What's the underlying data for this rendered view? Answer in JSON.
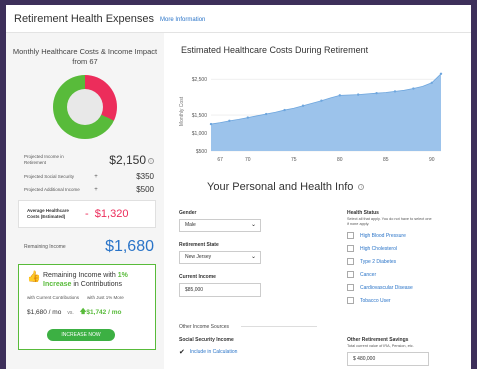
{
  "header": {
    "title": "Retirement Health Expenses",
    "more_link": "More Information"
  },
  "left": {
    "donut_title": "Monthly Healthcare Costs & Income Impact from 67",
    "donut_colors": {
      "costs": "#ec2d5b",
      "income": "#58bb3a"
    },
    "donut_cost_fraction": 0.32,
    "projected_income": {
      "label": "Projected Income in Retirement",
      "value": "$2,150"
    },
    "social_security": {
      "label": "Projected Social Security",
      "sym": "+",
      "value": "$350"
    },
    "additional_income": {
      "label": "Projected Additional Income",
      "sym": "+",
      "value": "$500"
    },
    "avg_healthcare": {
      "label": "Average Healthcare Costs (Estimated)",
      "sym": "-",
      "value": "$1,320"
    },
    "remaining": {
      "label": "Remaining Income",
      "value": "$1,680"
    },
    "promo": {
      "title_a": "Remaining Income with",
      "pct": "1%",
      "title_b": "Increase",
      "title_c": "in Contributions",
      "col_current": "with Current Contributions",
      "col_more": "with Just 1% More",
      "current_value": "$1,680 / mo",
      "vs": "vs.",
      "more_value": "$1,742 / mo",
      "button": "INCREASE NOW"
    }
  },
  "chart": {
    "title": "Estimated Healthcare Costs During Retirement",
    "ylabel": "Monthly Cost",
    "ytick_labels": [
      "$2,500",
      "$1,500",
      "$1,000",
      "$500"
    ],
    "xtick_labels": [
      "67",
      "70",
      "75",
      "80",
      "85",
      "90"
    ]
  },
  "chart_data": {
    "type": "area",
    "title": "Estimated Healthcare Costs During Retirement",
    "xlabel": "",
    "ylabel": "Monthly Cost",
    "x": [
      66,
      67,
      68,
      69,
      70,
      71,
      72,
      73,
      74,
      75,
      76,
      77,
      78,
      79,
      80,
      81,
      82,
      83,
      84,
      85,
      86,
      87,
      88,
      89,
      90,
      91
    ],
    "values": [
      1250,
      1290,
      1340,
      1380,
      1430,
      1480,
      1530,
      1580,
      1640,
      1690,
      1760,
      1830,
      1900,
      1980,
      2050,
      2060,
      2070,
      2090,
      2110,
      2130,
      2160,
      2190,
      2240,
      2300,
      2400,
      2650
    ],
    "ylim": [
      500,
      2700
    ],
    "xlim": [
      66,
      91
    ],
    "ytick_positions": [
      2500,
      1500,
      1000,
      500
    ],
    "xtick_positions": [
      67,
      70,
      75,
      80,
      85,
      90
    ],
    "grid": true,
    "colors": {
      "fill": "#9cc3eb",
      "line": "#6ea6de"
    }
  },
  "form": {
    "section_title": "Your Personal and Health Info",
    "gender": {
      "label": "Gender",
      "value": "Male"
    },
    "state": {
      "label": "Retirement State",
      "value": "New Jersey"
    },
    "income": {
      "label": "Current Income",
      "value": "$85,000"
    },
    "health": {
      "label": "Health Status",
      "sub": "Select all that apply. You do not have to select one if none apply.",
      "options": [
        "High Blood Pressure",
        "High Cholesterol",
        "Type 2 Diabetes",
        "Cancer",
        "Cardiovascular Disease",
        "Tobacco User"
      ]
    },
    "other_sources": "Other Income Sources",
    "social": {
      "label": "Social Security Income",
      "check_label": "Include in Calculation"
    },
    "savings": {
      "label": "Other Retirement Savings",
      "sub": "Total current value of IRA, Pension, etc.",
      "value": "$ 480,000"
    }
  }
}
